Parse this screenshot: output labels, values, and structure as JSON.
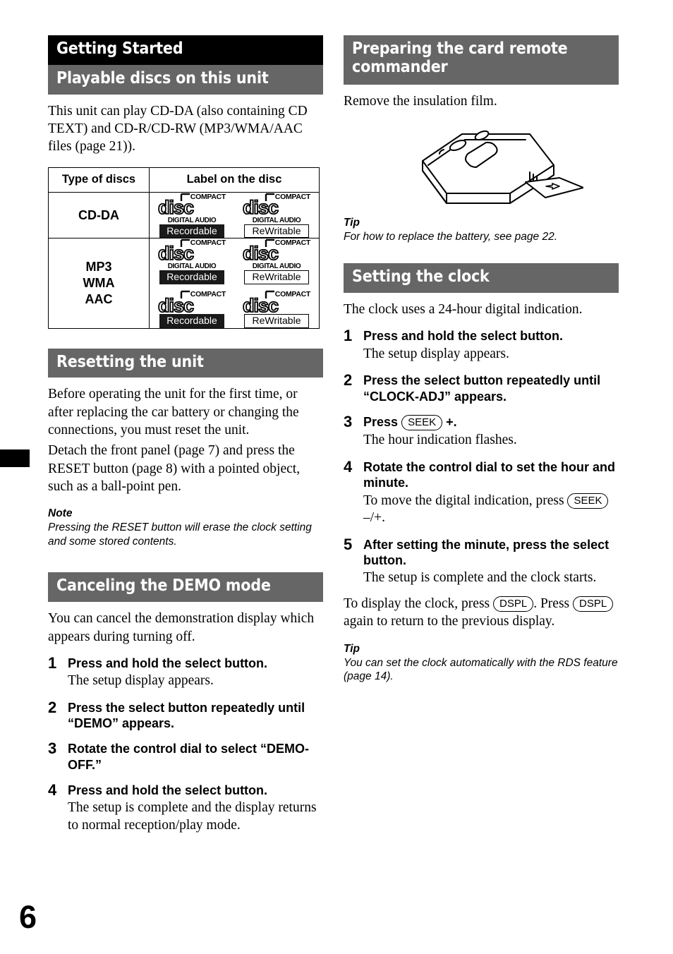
{
  "page": {
    "number": "6"
  },
  "left_column": {
    "chapter_title": "Getting Started",
    "section_playable": {
      "heading": "Playable discs on this unit",
      "intro": "This unit can play CD-DA (also containing CD TEXT) and CD-R/CD-RW (MP3/WMA/AAC files (page 21))."
    },
    "disc_table": {
      "headers": [
        "Type of discs",
        "Label on the disc"
      ],
      "rows": [
        {
          "type": "CD-DA",
          "logo_rows": [
            [
              {
                "top": "COMPACT",
                "mid": "disc",
                "sub": "DIGITAL AUDIO",
                "badge": "Recordable",
                "badge_style": "rec"
              },
              {
                "top": "COMPACT",
                "mid": "disc",
                "sub": "DIGITAL AUDIO",
                "badge": "ReWritable",
                "badge_style": "rew"
              }
            ]
          ]
        },
        {
          "type": "MP3\nWMA\nAAC",
          "type_lines": [
            "MP3",
            "WMA",
            "AAC"
          ],
          "logo_rows": [
            [
              {
                "top": "COMPACT",
                "mid": "disc",
                "sub": "DIGITAL AUDIO",
                "badge": "Recordable",
                "badge_style": "rec"
              },
              {
                "top": "COMPACT",
                "mid": "disc",
                "sub": "DIGITAL AUDIO",
                "badge": "ReWritable",
                "badge_style": "rew"
              }
            ],
            [
              {
                "top": "COMPACT",
                "mid": "disc",
                "sub": "",
                "badge": "Recordable",
                "badge_style": "rec"
              },
              {
                "top": "COMPACT",
                "mid": "disc",
                "sub": "",
                "badge": "ReWritable",
                "badge_style": "rew"
              }
            ]
          ]
        }
      ]
    },
    "section_reset": {
      "heading": "Resetting the unit",
      "para1": "Before operating the unit for the first time, or after replacing the car battery or changing the connections, you must reset the unit.",
      "para2": "Detach the front panel (page 7) and press the RESET button (page 8) with a pointed object, such as a ball-point pen.",
      "note_label": "Note",
      "note_body": "Pressing the RESET button will erase the clock setting and some stored contents."
    },
    "section_demo": {
      "heading": "Canceling the DEMO mode",
      "intro": "You can cancel the demonstration display which appears during turning off.",
      "steps": [
        {
          "num": "1",
          "title": "Press and hold the select button.",
          "desc": "The setup display appears."
        },
        {
          "num": "2",
          "title": "Press the select button repeatedly until “DEMO” appears.",
          "desc": ""
        },
        {
          "num": "3",
          "title": "Rotate the control dial to select “DEMO-OFF.”",
          "desc": ""
        },
        {
          "num": "4",
          "title": "Press and hold the select button.",
          "desc": "The setup is complete and the display returns to normal reception/play mode."
        }
      ]
    }
  },
  "right_column": {
    "section_remote": {
      "heading": "Preparing the card remote commander",
      "intro": "Remove the insulation film.",
      "illustration_name": "card-remote-commander-insulation-film",
      "tip_label": "Tip",
      "tip_body": "For how to replace the battery, see page 22."
    },
    "section_clock": {
      "heading": "Setting the clock",
      "intro": "The clock uses a 24-hour digital indication.",
      "steps": [
        {
          "num": "1",
          "title": "Press and hold the select button.",
          "desc": "The setup display appears."
        },
        {
          "num": "2",
          "title": "Press the select button repeatedly until “CLOCK-ADJ” appears.",
          "desc": ""
        },
        {
          "num": "3",
          "title_pre": "Press",
          "key": "SEEK",
          "title_post": "+.",
          "desc": "The hour indication flashes."
        },
        {
          "num": "4",
          "title": "Rotate the control dial to set the hour and minute.",
          "desc_pre": "To move the digital indication, press",
          "key": "SEEK",
          "desc_post": "–/+."
        },
        {
          "num": "5",
          "title": "After setting the minute, press the select button.",
          "desc": "The setup is complete and the clock starts."
        }
      ],
      "closing_pre": "To display the clock, press",
      "closing_key1": "DSPL",
      "closing_mid": ". Press",
      "closing_key2": "DSPL",
      "closing_post": "again to return to the previous display.",
      "tip_label": "Tip",
      "tip_body": "You can set the clock automatically with the RDS feature (page 14)."
    }
  },
  "colors": {
    "chapter_band": "#000000",
    "section_band": "#666666",
    "text": "#000000",
    "badge_recordable_bg": "#1a1a1a",
    "page_bg": "#ffffff"
  }
}
